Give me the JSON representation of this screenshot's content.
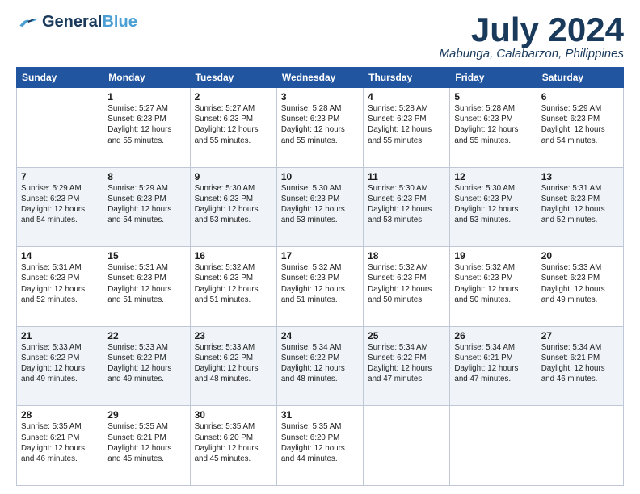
{
  "header": {
    "logo_general": "General",
    "logo_blue": "Blue",
    "month": "July 2024",
    "location": "Mabunga, Calabarzon, Philippines"
  },
  "days_of_week": [
    "Sunday",
    "Monday",
    "Tuesday",
    "Wednesday",
    "Thursday",
    "Friday",
    "Saturday"
  ],
  "weeks": [
    [
      {
        "day": "",
        "sunrise": "",
        "sunset": "",
        "daylight": ""
      },
      {
        "day": "1",
        "sunrise": "Sunrise: 5:27 AM",
        "sunset": "Sunset: 6:23 PM",
        "daylight": "Daylight: 12 hours and 55 minutes."
      },
      {
        "day": "2",
        "sunrise": "Sunrise: 5:27 AM",
        "sunset": "Sunset: 6:23 PM",
        "daylight": "Daylight: 12 hours and 55 minutes."
      },
      {
        "day": "3",
        "sunrise": "Sunrise: 5:28 AM",
        "sunset": "Sunset: 6:23 PM",
        "daylight": "Daylight: 12 hours and 55 minutes."
      },
      {
        "day": "4",
        "sunrise": "Sunrise: 5:28 AM",
        "sunset": "Sunset: 6:23 PM",
        "daylight": "Daylight: 12 hours and 55 minutes."
      },
      {
        "day": "5",
        "sunrise": "Sunrise: 5:28 AM",
        "sunset": "Sunset: 6:23 PM",
        "daylight": "Daylight: 12 hours and 55 minutes."
      },
      {
        "day": "6",
        "sunrise": "Sunrise: 5:29 AM",
        "sunset": "Sunset: 6:23 PM",
        "daylight": "Daylight: 12 hours and 54 minutes."
      }
    ],
    [
      {
        "day": "7",
        "sunrise": "Sunrise: 5:29 AM",
        "sunset": "Sunset: 6:23 PM",
        "daylight": "Daylight: 12 hours and 54 minutes."
      },
      {
        "day": "8",
        "sunrise": "Sunrise: 5:29 AM",
        "sunset": "Sunset: 6:23 PM",
        "daylight": "Daylight: 12 hours and 54 minutes."
      },
      {
        "day": "9",
        "sunrise": "Sunrise: 5:30 AM",
        "sunset": "Sunset: 6:23 PM",
        "daylight": "Daylight: 12 hours and 53 minutes."
      },
      {
        "day": "10",
        "sunrise": "Sunrise: 5:30 AM",
        "sunset": "Sunset: 6:23 PM",
        "daylight": "Daylight: 12 hours and 53 minutes."
      },
      {
        "day": "11",
        "sunrise": "Sunrise: 5:30 AM",
        "sunset": "Sunset: 6:23 PM",
        "daylight": "Daylight: 12 hours and 53 minutes."
      },
      {
        "day": "12",
        "sunrise": "Sunrise: 5:30 AM",
        "sunset": "Sunset: 6:23 PM",
        "daylight": "Daylight: 12 hours and 53 minutes."
      },
      {
        "day": "13",
        "sunrise": "Sunrise: 5:31 AM",
        "sunset": "Sunset: 6:23 PM",
        "daylight": "Daylight: 12 hours and 52 minutes."
      }
    ],
    [
      {
        "day": "14",
        "sunrise": "Sunrise: 5:31 AM",
        "sunset": "Sunset: 6:23 PM",
        "daylight": "Daylight: 12 hours and 52 minutes."
      },
      {
        "day": "15",
        "sunrise": "Sunrise: 5:31 AM",
        "sunset": "Sunset: 6:23 PM",
        "daylight": "Daylight: 12 hours and 51 minutes."
      },
      {
        "day": "16",
        "sunrise": "Sunrise: 5:32 AM",
        "sunset": "Sunset: 6:23 PM",
        "daylight": "Daylight: 12 hours and 51 minutes."
      },
      {
        "day": "17",
        "sunrise": "Sunrise: 5:32 AM",
        "sunset": "Sunset: 6:23 PM",
        "daylight": "Daylight: 12 hours and 51 minutes."
      },
      {
        "day": "18",
        "sunrise": "Sunrise: 5:32 AM",
        "sunset": "Sunset: 6:23 PM",
        "daylight": "Daylight: 12 hours and 50 minutes."
      },
      {
        "day": "19",
        "sunrise": "Sunrise: 5:32 AM",
        "sunset": "Sunset: 6:23 PM",
        "daylight": "Daylight: 12 hours and 50 minutes."
      },
      {
        "day": "20",
        "sunrise": "Sunrise: 5:33 AM",
        "sunset": "Sunset: 6:23 PM",
        "daylight": "Daylight: 12 hours and 49 minutes."
      }
    ],
    [
      {
        "day": "21",
        "sunrise": "Sunrise: 5:33 AM",
        "sunset": "Sunset: 6:22 PM",
        "daylight": "Daylight: 12 hours and 49 minutes."
      },
      {
        "day": "22",
        "sunrise": "Sunrise: 5:33 AM",
        "sunset": "Sunset: 6:22 PM",
        "daylight": "Daylight: 12 hours and 49 minutes."
      },
      {
        "day": "23",
        "sunrise": "Sunrise: 5:33 AM",
        "sunset": "Sunset: 6:22 PM",
        "daylight": "Daylight: 12 hours and 48 minutes."
      },
      {
        "day": "24",
        "sunrise": "Sunrise: 5:34 AM",
        "sunset": "Sunset: 6:22 PM",
        "daylight": "Daylight: 12 hours and 48 minutes."
      },
      {
        "day": "25",
        "sunrise": "Sunrise: 5:34 AM",
        "sunset": "Sunset: 6:22 PM",
        "daylight": "Daylight: 12 hours and 47 minutes."
      },
      {
        "day": "26",
        "sunrise": "Sunrise: 5:34 AM",
        "sunset": "Sunset: 6:21 PM",
        "daylight": "Daylight: 12 hours and 47 minutes."
      },
      {
        "day": "27",
        "sunrise": "Sunrise: 5:34 AM",
        "sunset": "Sunset: 6:21 PM",
        "daylight": "Daylight: 12 hours and 46 minutes."
      }
    ],
    [
      {
        "day": "28",
        "sunrise": "Sunrise: 5:35 AM",
        "sunset": "Sunset: 6:21 PM",
        "daylight": "Daylight: 12 hours and 46 minutes."
      },
      {
        "day": "29",
        "sunrise": "Sunrise: 5:35 AM",
        "sunset": "Sunset: 6:21 PM",
        "daylight": "Daylight: 12 hours and 45 minutes."
      },
      {
        "day": "30",
        "sunrise": "Sunrise: 5:35 AM",
        "sunset": "Sunset: 6:20 PM",
        "daylight": "Daylight: 12 hours and 45 minutes."
      },
      {
        "day": "31",
        "sunrise": "Sunrise: 5:35 AM",
        "sunset": "Sunset: 6:20 PM",
        "daylight": "Daylight: 12 hours and 44 minutes."
      },
      {
        "day": "",
        "sunrise": "",
        "sunset": "",
        "daylight": ""
      },
      {
        "day": "",
        "sunrise": "",
        "sunset": "",
        "daylight": ""
      },
      {
        "day": "",
        "sunrise": "",
        "sunset": "",
        "daylight": ""
      }
    ]
  ]
}
